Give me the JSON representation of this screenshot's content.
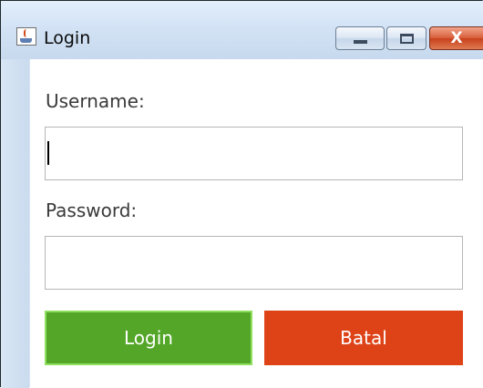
{
  "window": {
    "title": "Login",
    "icon": "java-cup-icon",
    "controls": {
      "minimize": "minimize-icon",
      "maximize": "maximize-icon",
      "close_glyph": "X"
    }
  },
  "form": {
    "username_label": "Username:",
    "username_value": "",
    "password_label": "Password:",
    "password_value": "",
    "login_label": "Login",
    "cancel_label": "Batal"
  },
  "colors": {
    "login_button": "#53a628",
    "cancel_button": "#de4318"
  }
}
